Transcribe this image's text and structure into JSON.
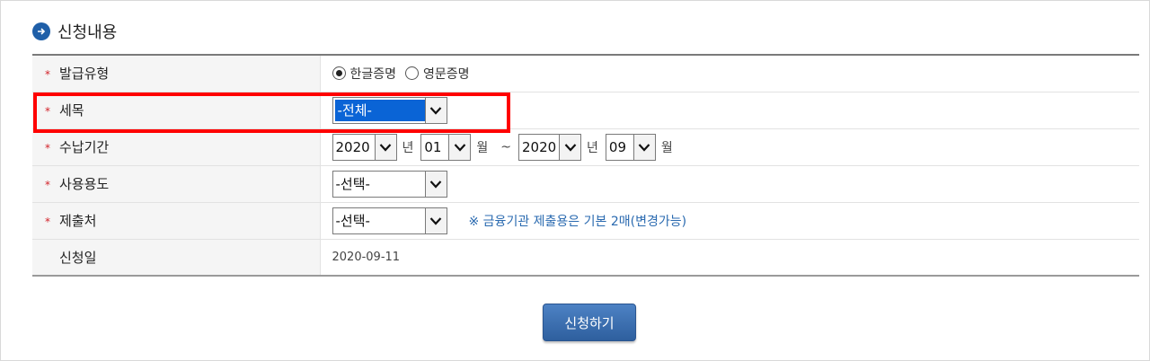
{
  "section": {
    "title": "신청내용",
    "icon": "arrow-circle-icon"
  },
  "form": {
    "issue_type": {
      "label": "발급유형",
      "options": [
        {
          "label": "한글증명",
          "selected": true
        },
        {
          "label": "영문증명",
          "selected": false
        }
      ]
    },
    "tax_item": {
      "label": "세목",
      "value": "-전체-"
    },
    "period": {
      "label": "수납기간",
      "from_year": "2020",
      "from_month": "01",
      "to_year": "2020",
      "to_month": "09",
      "year_unit": "년",
      "month_unit": "월",
      "tilde": "~"
    },
    "usage": {
      "label": "사용용도",
      "value": "-선택-"
    },
    "recipient": {
      "label": "제출처",
      "value": "-선택-",
      "note": "※ 금융기관 제출용은 기본 2매(변경가능)"
    },
    "apply_date": {
      "label": "신청일",
      "value": "2020-09-11"
    },
    "required_mark": "*"
  },
  "submit_label": "신청하기",
  "colors": {
    "accent": "#1f5fa8",
    "required": "#d2232a",
    "highlight": "#ff0000",
    "note": "#2a6ab0",
    "button": "#3a6eb0"
  }
}
